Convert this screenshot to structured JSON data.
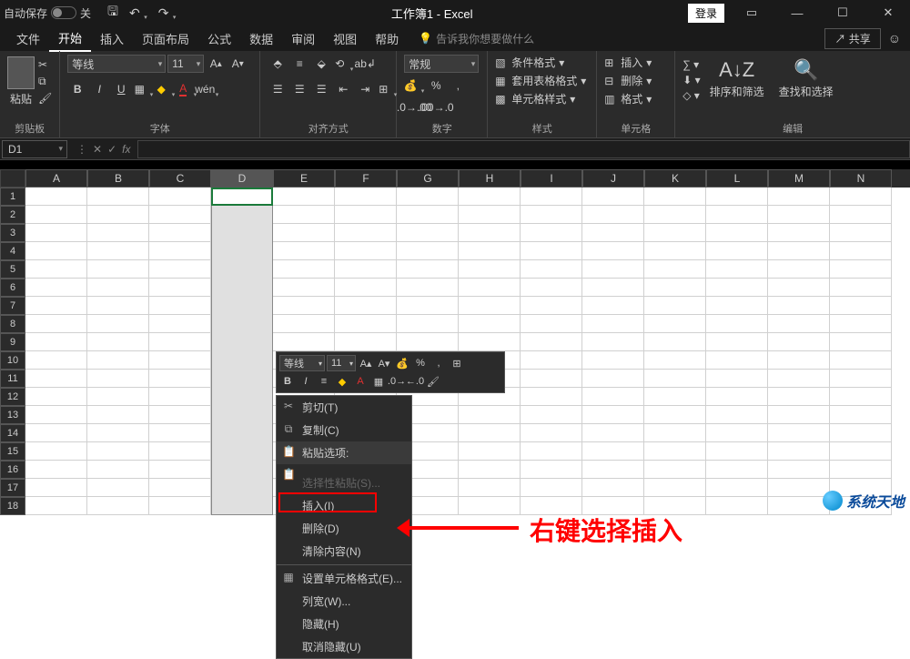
{
  "titlebar": {
    "autosave": "自动保存",
    "off": "关",
    "title": "工作簿1 - Excel",
    "login": "登录"
  },
  "tabs": {
    "file": "文件",
    "home": "开始",
    "insert": "插入",
    "layout": "页面布局",
    "formulas": "公式",
    "data": "数据",
    "review": "审阅",
    "view": "视图",
    "help": "帮助",
    "tellme": "告诉我你想要做什么",
    "share": "共享"
  },
  "ribbon": {
    "clipboard": {
      "paste": "粘贴",
      "label": "剪贴板"
    },
    "font": {
      "name": "等线",
      "size": "11",
      "label": "字体"
    },
    "align": {
      "label": "对齐方式"
    },
    "number": {
      "format": "常规",
      "label": "数字"
    },
    "styles": {
      "cond": "条件格式",
      "table": "套用表格格式",
      "cell": "单元格样式",
      "label": "样式"
    },
    "cells": {
      "insert": "插入",
      "delete": "删除",
      "format": "格式",
      "label": "单元格"
    },
    "editing": {
      "sort": "排序和筛选",
      "find": "查找和选择",
      "label": "编辑"
    }
  },
  "namebox": "D1",
  "columns": [
    "A",
    "B",
    "C",
    "D",
    "E",
    "F",
    "G",
    "H",
    "I",
    "J",
    "K",
    "L",
    "M",
    "N"
  ],
  "rows_count": 18,
  "minibar": {
    "font": "等线",
    "size": "11"
  },
  "context_menu": {
    "cut": "剪切(T)",
    "copy": "复制(C)",
    "paste_opts": "粘贴选项:",
    "paste_special": "选择性粘贴(S)...",
    "insert": "插入(I)",
    "delete": "删除(D)",
    "clear": "清除内容(N)",
    "format_cells": "设置单元格格式(E)...",
    "col_width": "列宽(W)...",
    "hide": "隐藏(H)",
    "unhide": "取消隐藏(U)"
  },
  "annotation": "右键选择插入",
  "watermark": "系统天地"
}
